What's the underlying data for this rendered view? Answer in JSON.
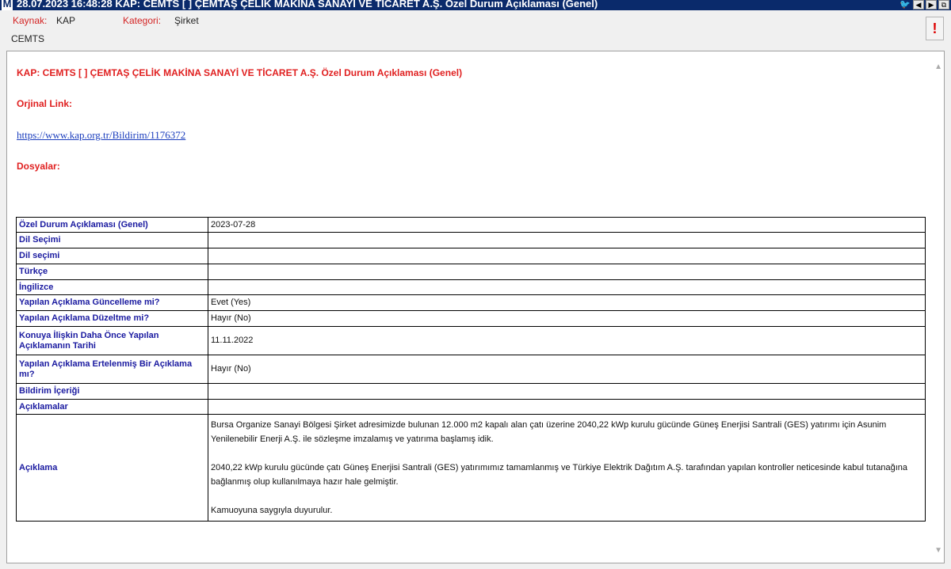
{
  "window": {
    "logo_letter": "M",
    "title": "28.07.2023 16:48:28 KAP: CEMTS  [ ] ÇEMTAŞ ÇELİK MAKİNA SANAYİ VE TİCARET A.Ş.  Özel Durum Açıklaması (Genel)",
    "controls": [
      "twitter-icon",
      "prev-icon",
      "next-icon",
      "restore-icon"
    ]
  },
  "meta": {
    "source_label": "Kaynak:",
    "source_value": "KAP",
    "category_label": "Kategori:",
    "category_value": "Şirket",
    "symbol": "CEMTS",
    "alert_label": "!"
  },
  "document": {
    "heading": "KAP: CEMTS [ ] ÇEMTAŞ ÇELİK MAKİNA SANAYİ VE TİCARET A.Ş. Özel Durum Açıklaması (Genel)",
    "original_link_label": "Orjinal Link:",
    "original_link_url": "https://www.kap.org.tr/Bildirim/1176372",
    "files_label": "Dosyalar:"
  },
  "table": {
    "rows": [
      {
        "key": "Özel Durum Açıklaması (Genel)",
        "value": "2023-07-28"
      },
      {
        "key": "Dil Seçimi",
        "value": ""
      },
      {
        "key": "Dil seçimi",
        "value": ""
      },
      {
        "key": "Türkçe",
        "value": ""
      },
      {
        "key": "İngilizce",
        "value": ""
      },
      {
        "key": "Yapılan Açıklama Güncelleme mi?",
        "value": "Evet (Yes)"
      },
      {
        "key": "Yapılan Açıklama Düzeltme mi?",
        "value": "Hayır (No)"
      },
      {
        "key": "Konuya İlişkin Daha Önce Yapılan Açıklamanın Tarihi",
        "value": "11.11.2022"
      },
      {
        "key": "Yapılan Açıklama Ertelenmiş Bir Açıklama mı?",
        "value": "Hayır (No)"
      },
      {
        "key": "Bildirim İçeriği",
        "value": ""
      },
      {
        "key": "Açıklamalar",
        "value": ""
      }
    ],
    "description_key": "Açıklama",
    "description_paragraphs": [
      "Bursa Organize Sanayi Bölgesi Şirket adresimizde bulunan 12.000 m2 kapalı alan çatı üzerine 2040,22 kWp kurulu gücünde Güneş Enerjisi Santrali (GES) yatırımı için Asunim Yenilenebilir Enerji A.Ş. ile sözleşme imzalamış ve yatırıma başlamış idik.",
      "2040,22 kWp kurulu gücünde çatı Güneş Enerjisi Santrali (GES) yatırımımız tamamlanmış ve Türkiye Elektrik Dağıtım A.Ş. tarafından yapılan kontroller neticesinde kabul tutanağına bağlanmış olup kullanılmaya hazır hale gelmiştir.",
      "Kamuoyuna saygıyla duyurulur."
    ]
  }
}
